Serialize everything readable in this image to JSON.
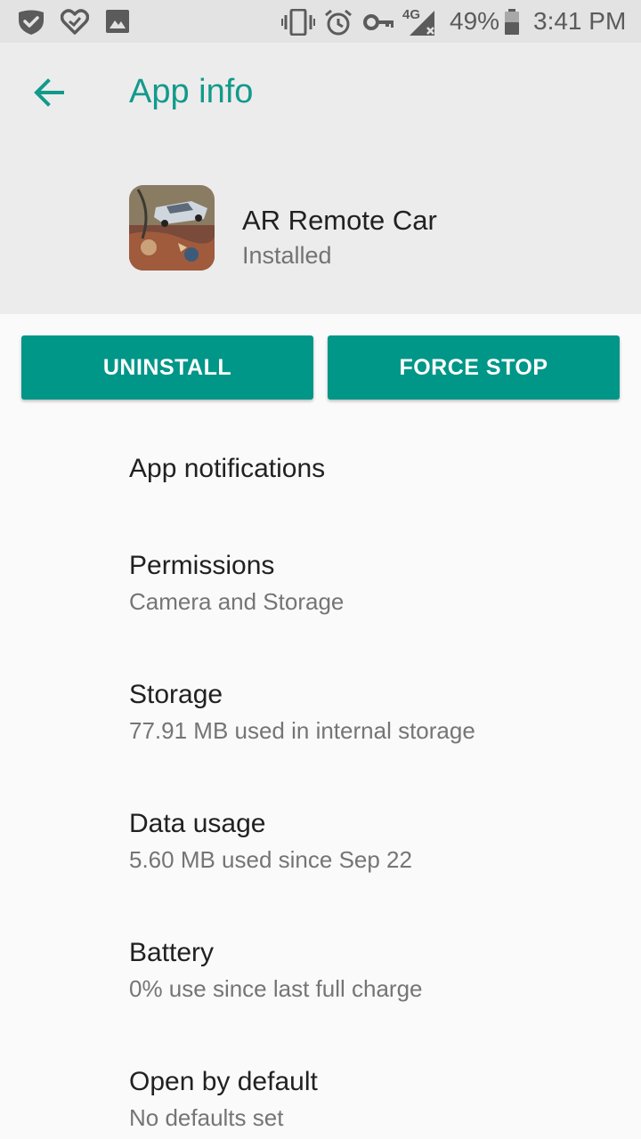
{
  "status_bar": {
    "battery_percent": "49%",
    "time": "3:41 PM",
    "network": "4G",
    "icons": [
      "shield-check-icon",
      "heart-check-icon",
      "image-icon",
      "vibrate-icon",
      "alarm-icon",
      "key-icon",
      "signal-icon",
      "battery-icon"
    ]
  },
  "app_bar": {
    "title": "App info",
    "back_icon": "arrow-back-icon"
  },
  "app": {
    "name": "AR Remote Car",
    "status": "Installed",
    "icon": "app-thumbnail"
  },
  "actions": {
    "uninstall_label": "UNINSTALL",
    "force_stop_label": "FORCE STOP"
  },
  "settings": [
    {
      "title": "App notifications",
      "subtitle": ""
    },
    {
      "title": "Permissions",
      "subtitle": "Camera and Storage"
    },
    {
      "title": "Storage",
      "subtitle": "77.91 MB used in internal storage"
    },
    {
      "title": "Data usage",
      "subtitle": "5.60 MB used since Sep 22"
    },
    {
      "title": "Battery",
      "subtitle": "0% use since last full charge"
    },
    {
      "title": "Open by default",
      "subtitle": "No defaults set"
    }
  ],
  "colors": {
    "accent": "#009688",
    "title_teal": "#129a8b",
    "header_bg": "#ececec",
    "status_bar_bg": "#e3e3e3",
    "background": "#fafafa"
  }
}
